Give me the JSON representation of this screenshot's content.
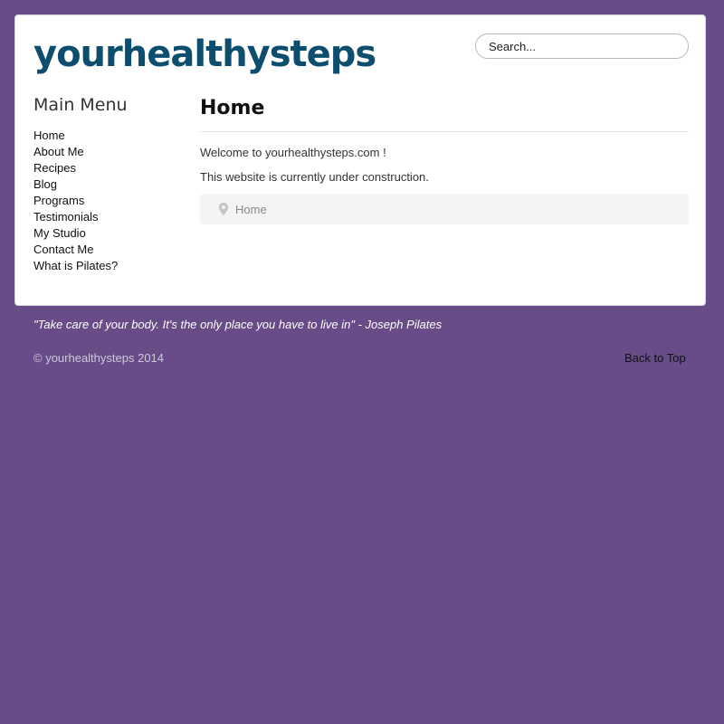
{
  "header": {
    "site_name": "yourhealthysteps",
    "search_placeholder": "Search..."
  },
  "sidebar": {
    "title": "Main Menu",
    "items": [
      {
        "label": "Home"
      },
      {
        "label": "About Me"
      },
      {
        "label": "Recipes"
      },
      {
        "label": "Blog"
      },
      {
        "label": "Programs"
      },
      {
        "label": "Testimonials"
      },
      {
        "label": "My Studio"
      },
      {
        "label": "Contact Me"
      },
      {
        "label": "What is Pilates?"
      }
    ]
  },
  "main": {
    "title": "Home",
    "paragraphs": [
      "Welcome to yourhealthysteps.com !",
      "This website is currently under construction."
    ],
    "breadcrumb": {
      "icon": "map-pin-icon",
      "label": "Home"
    }
  },
  "footer": {
    "quote": "\"Take care of your body. It's the only place you have to live in\" - Joseph Pilates",
    "copyright": "© yourhealthysteps 2014",
    "back_to_top": "Back to Top"
  },
  "colors": {
    "background": "#674c87",
    "logo": "#0d4d6e",
    "card": "#ffffff"
  }
}
